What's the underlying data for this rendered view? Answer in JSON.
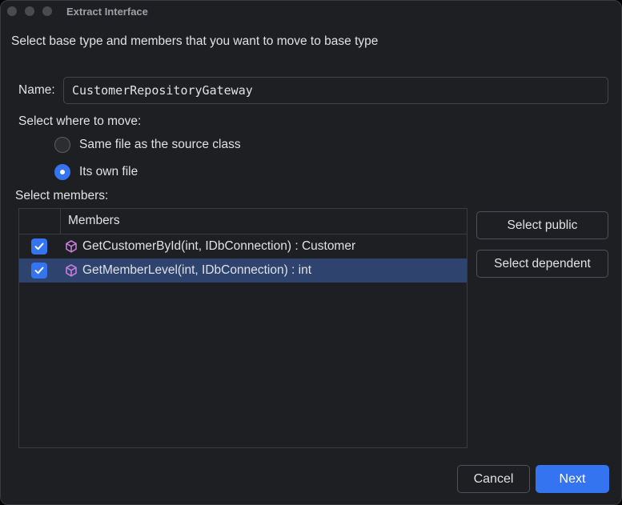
{
  "window": {
    "title": "Extract Interface"
  },
  "dialog": {
    "instruction": "Select base type and members that you want to move to base type",
    "name_label": "Name:",
    "name_value": "CustomerRepositoryGateway",
    "where_label": "Select where to move:",
    "move_options": [
      {
        "label": "Same file as the source class",
        "selected": false
      },
      {
        "label": "Its own file",
        "selected": true
      }
    ],
    "members_label": "Select members:",
    "members_table": {
      "column_header": "Members",
      "rows": [
        {
          "label": "GetCustomerById(int, IDbConnection) : Customer",
          "checked": true,
          "selected": false
        },
        {
          "label": "GetMemberLevel(int, IDbConnection) : int",
          "checked": true,
          "selected": true
        }
      ]
    },
    "side_buttons": {
      "select_public": "Select public",
      "select_dependent": "Select dependent"
    },
    "footer": {
      "cancel": "Cancel",
      "next": "Next"
    }
  },
  "icons": {
    "member": "method-cube-icon",
    "check": "check-icon"
  },
  "colors": {
    "accent": "#3574f0",
    "background": "#1e1f22",
    "selected_row": "#2e436e",
    "member_icon": "#c77dd9"
  }
}
